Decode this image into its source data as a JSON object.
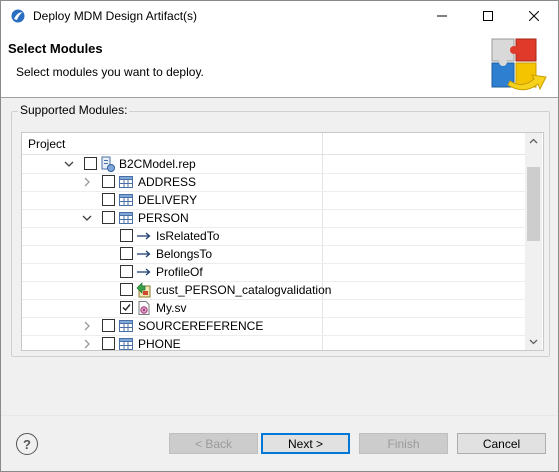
{
  "window": {
    "title": "Deploy MDM Design Artifact(s)"
  },
  "header": {
    "title": "Select Modules",
    "description": "Select modules you want to deploy."
  },
  "group": {
    "label": "Supported Modules:"
  },
  "tree": {
    "column_header": "Project",
    "rows": [
      {
        "label": "B2CModel.rep",
        "checked": false,
        "expanded": true,
        "icon": "repository-icon"
      },
      {
        "label": "ADDRESS",
        "checked": false,
        "expanded": false,
        "icon": "table-icon"
      },
      {
        "label": "DELIVERY",
        "checked": false,
        "icon": "table-icon"
      },
      {
        "label": "PERSON",
        "checked": false,
        "expanded": true,
        "icon": "table-icon"
      },
      {
        "label": "IsRelatedTo",
        "checked": false,
        "icon": "relationship-arrow-icon"
      },
      {
        "label": "BelongsTo",
        "checked": false,
        "icon": "relationship-arrow-icon"
      },
      {
        "label": "ProfileOf",
        "checked": false,
        "icon": "relationship-arrow-icon"
      },
      {
        "label": "cust_PERSON_catalogvalidation",
        "checked": false,
        "icon": "validation-script-icon"
      },
      {
        "label": "My.sv",
        "checked": true,
        "icon": "saved-view-icon"
      },
      {
        "label": "SOURCEREFERENCE",
        "checked": false,
        "expanded": false,
        "icon": "table-icon"
      },
      {
        "label": "PHONE",
        "checked": false,
        "expanded": false,
        "icon": "table-icon"
      }
    ]
  },
  "buttons": {
    "help": "?",
    "back": "< Back",
    "next": "Next >",
    "finish": "Finish",
    "cancel": "Cancel"
  },
  "colors": {
    "accent": "#0078d7",
    "disabled_text": "#9a9a9a"
  }
}
